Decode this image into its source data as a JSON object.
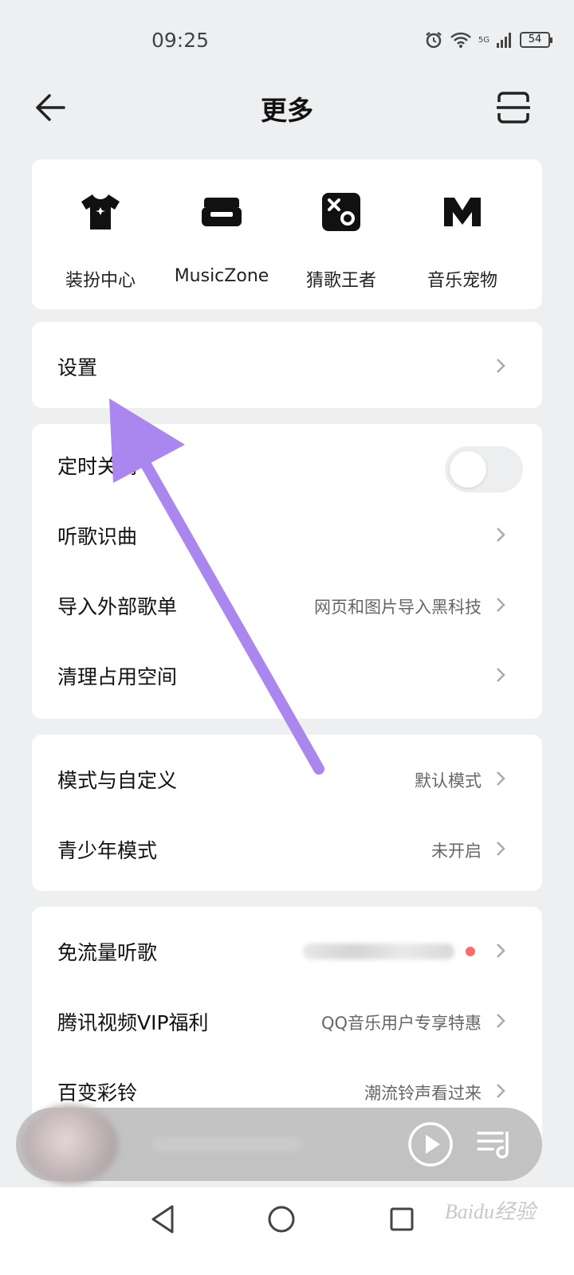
{
  "status_bar": {
    "time": "09:25",
    "network": "5G",
    "battery": "54"
  },
  "header": {
    "title": "更多"
  },
  "quick_actions": [
    {
      "label": "装扮中心",
      "icon": "tshirt-icon"
    },
    {
      "label": "MusicZone",
      "icon": "sofa-icon"
    },
    {
      "label": "猜歌王者",
      "icon": "dice-icon"
    },
    {
      "label": "音乐宠物",
      "icon": "m-logo-icon"
    }
  ],
  "settings_row": {
    "label": "设置"
  },
  "group_tools": [
    {
      "label": "定时关闭",
      "toggle_on": false
    },
    {
      "label": "听歌识曲",
      "value": ""
    },
    {
      "label": "导入外部歌单",
      "value": "网页和图片导入黑科技"
    },
    {
      "label": "清理占用空间",
      "value": ""
    }
  ],
  "group_modes": [
    {
      "label": "模式与自定义",
      "value": "默认模式"
    },
    {
      "label": "青少年模式",
      "value": "未开启"
    }
  ],
  "group_services": [
    {
      "label": "免流量听歌",
      "value_blurred": true
    },
    {
      "label": "腾讯视频VIP福利",
      "value": "QQ音乐用户专享特惠"
    },
    {
      "label": "百变彩铃",
      "value": "潮流铃声看过来"
    }
  ],
  "watermark": "Baidu经验",
  "colors": {
    "accent_annotation": "#a987ee",
    "background": "#edeff1"
  }
}
